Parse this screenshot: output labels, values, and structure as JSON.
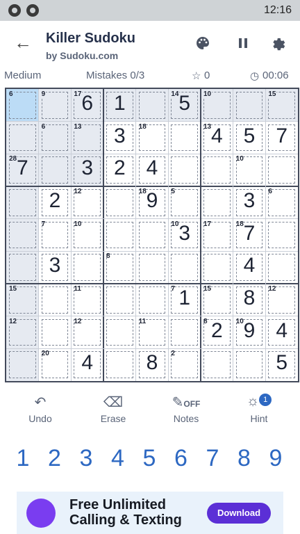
{
  "status": {
    "time": "12:16",
    "icons": [
      "app-notification-icon",
      "app-notification-icon"
    ]
  },
  "header": {
    "title": "Killer Sudoku",
    "subtitle": "by Sudoku.com",
    "icons": [
      "back-arrow-icon",
      "palette-icon",
      "pause-icon",
      "gear-icon"
    ]
  },
  "info": {
    "difficulty": "Medium",
    "mistakes": "Mistakes 0/3",
    "score": "0",
    "timer": "00:06"
  },
  "board": {
    "selected": [
      0,
      0
    ],
    "digits": [
      [
        "",
        "",
        "6",
        "1",
        "",
        "5",
        "",
        "",
        ""
      ],
      [
        "",
        "",
        "",
        "3",
        "",
        "",
        "4",
        "5",
        "7"
      ],
      [
        "7",
        "",
        "3",
        "2",
        "4",
        "",
        "",
        "",
        ""
      ],
      [
        "",
        "2",
        "",
        "",
        "9",
        "",
        "",
        "3",
        ""
      ],
      [
        "",
        "",
        "",
        "",
        "",
        "3",
        "",
        "7",
        ""
      ],
      [
        "",
        "3",
        "",
        "",
        "",
        "",
        "",
        "4",
        ""
      ],
      [
        "",
        "",
        "",
        "",
        "",
        "1",
        "",
        "8",
        ""
      ],
      [
        "",
        "",
        "",
        "",
        "",
        "",
        "2",
        "9",
        "4"
      ],
      [
        "",
        "",
        "4",
        "",
        "8",
        "",
        "",
        "",
        "5"
      ]
    ],
    "cage_sums": [
      {
        "r": 0,
        "c": 0,
        "sum": "6"
      },
      {
        "r": 0,
        "c": 1,
        "sum": "9"
      },
      {
        "r": 0,
        "c": 2,
        "sum": "17"
      },
      {
        "r": 0,
        "c": 5,
        "sum": "14"
      },
      {
        "r": 0,
        "c": 6,
        "sum": "10"
      },
      {
        "r": 0,
        "c": 8,
        "sum": "15"
      },
      {
        "r": 1,
        "c": 1,
        "sum": "6"
      },
      {
        "r": 1,
        "c": 2,
        "sum": "13"
      },
      {
        "r": 1,
        "c": 4,
        "sum": "18"
      },
      {
        "r": 1,
        "c": 6,
        "sum": "13"
      },
      {
        "r": 2,
        "c": 0,
        "sum": "28"
      },
      {
        "r": 2,
        "c": 7,
        "sum": "10"
      },
      {
        "r": 3,
        "c": 2,
        "sum": "12"
      },
      {
        "r": 3,
        "c": 4,
        "sum": "18"
      },
      {
        "r": 3,
        "c": 5,
        "sum": "5"
      },
      {
        "r": 3,
        "c": 8,
        "sum": "6"
      },
      {
        "r": 4,
        "c": 1,
        "sum": "7"
      },
      {
        "r": 4,
        "c": 2,
        "sum": "10"
      },
      {
        "r": 4,
        "c": 5,
        "sum": "10"
      },
      {
        "r": 4,
        "c": 6,
        "sum": "17"
      },
      {
        "r": 4,
        "c": 7,
        "sum": "18"
      },
      {
        "r": 5,
        "c": 3,
        "sum": "8"
      },
      {
        "r": 6,
        "c": 0,
        "sum": "15"
      },
      {
        "r": 6,
        "c": 2,
        "sum": "11"
      },
      {
        "r": 6,
        "c": 5,
        "sum": "7"
      },
      {
        "r": 6,
        "c": 6,
        "sum": "15"
      },
      {
        "r": 6,
        "c": 8,
        "sum": "12"
      },
      {
        "r": 7,
        "c": 0,
        "sum": "12"
      },
      {
        "r": 7,
        "c": 2,
        "sum": "12"
      },
      {
        "r": 7,
        "c": 4,
        "sum": "11"
      },
      {
        "r": 7,
        "c": 6,
        "sum": "8"
      },
      {
        "r": 7,
        "c": 7,
        "sum": "10"
      },
      {
        "r": 8,
        "c": 1,
        "sum": "20"
      },
      {
        "r": 8,
        "c": 5,
        "sum": "2"
      }
    ]
  },
  "tools": [
    {
      "label": "Undo",
      "icon": "undo-icon"
    },
    {
      "label": "Erase",
      "icon": "eraser-icon"
    },
    {
      "label": "Notes",
      "icon": "pencil-icon",
      "state": "OFF"
    },
    {
      "label": "Hint",
      "icon": "lightbulb-icon",
      "badge": "1"
    }
  ],
  "numpad": [
    "1",
    "2",
    "3",
    "4",
    "5",
    "6",
    "7",
    "8",
    "9"
  ],
  "ad": {
    "line1": "Free Unlimited",
    "line2": "Calling & Texting",
    "button": "Download"
  },
  "colors": {
    "accent": "#2d68c2",
    "selected": "#bcdcf6",
    "highlight": "#e6eaf1",
    "grid": "#434a5b"
  }
}
